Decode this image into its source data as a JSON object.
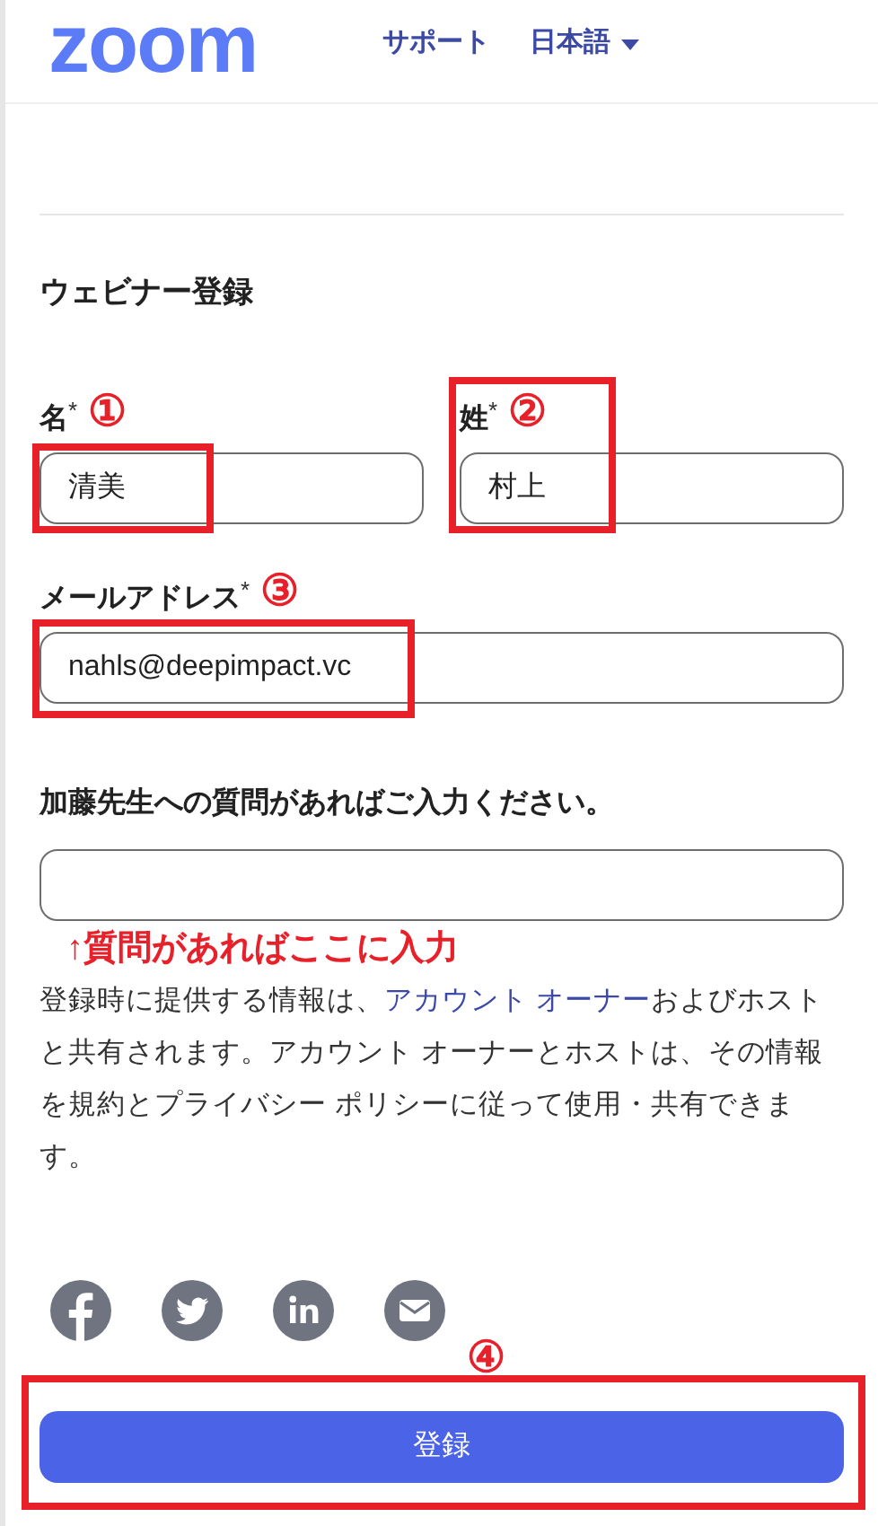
{
  "header": {
    "logo": "zoom",
    "links": [
      {
        "label": "サポート",
        "kind": "link"
      },
      {
        "label": "日本語",
        "kind": "dropdown"
      }
    ]
  },
  "form": {
    "title": "ウェビナー登録",
    "name_fields": [
      {
        "label": "名",
        "required": "*",
        "marker": "①",
        "value": "清美"
      },
      {
        "label": "姓",
        "required": "*",
        "marker": "②",
        "value": "村上"
      }
    ],
    "email": {
      "label": "メールアドレス",
      "required": "*",
      "marker": "③",
      "value": "nahls@deepimpact.vc"
    },
    "question": {
      "label": "加藤先生への質問があればご入力ください。",
      "annotation": "↑質問があればここに入力"
    },
    "notice": {
      "before": "登録時に提供する情報は、",
      "link": "アカウント オーナー",
      "after": "およびホストと共有されます。アカウント オーナーとホストは、その情報を規約とプライバシー ポリシーに従って使用・共有できます。"
    },
    "share_icons": [
      {
        "kind": "facebook"
      },
      {
        "kind": "twitter"
      },
      {
        "kind": "linkedin"
      },
      {
        "kind": "email"
      }
    ],
    "submit": {
      "marker": "④",
      "label": "登録"
    }
  }
}
